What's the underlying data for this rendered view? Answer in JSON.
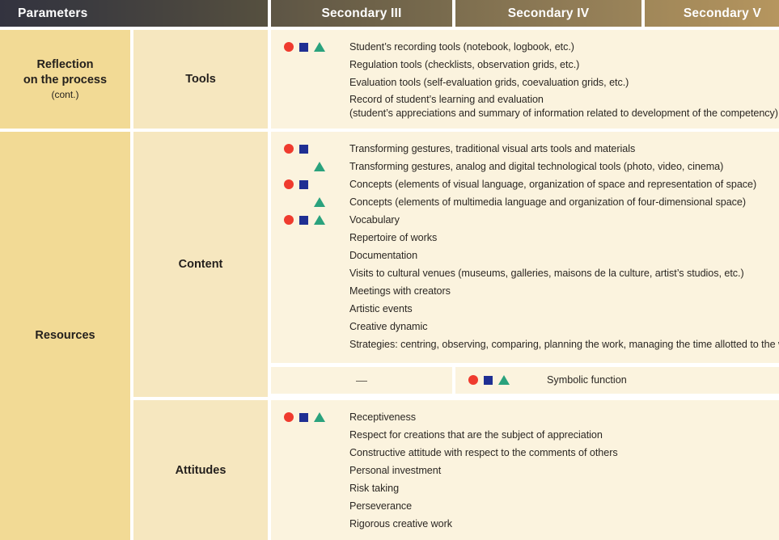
{
  "header": {
    "parameters_label": "Parameters",
    "columns": [
      {
        "label": "Secondary III"
      },
      {
        "label": "Secondary IV"
      },
      {
        "label": "Secondary V"
      }
    ]
  },
  "colors": {
    "circle": "#ef3b2e",
    "square": "#1f2f93",
    "triangle": "#2aa27d",
    "col1_bg": "#f2da95",
    "col2_bg": "#f6e7bf",
    "content_bg": "#fbf3de"
  },
  "parameters": {
    "reflection": {
      "title": "Reflection\non the process",
      "line1": "Reflection",
      "line2": "on the process",
      "note": "(cont.)"
    },
    "resources": {
      "label": "Resources"
    }
  },
  "sub_parameters": {
    "tools": "Tools",
    "content": "Content",
    "attitudes": "Attitudes"
  },
  "sections": {
    "tools": {
      "items": [
        {
          "marks": [
            "circle",
            "square",
            "triangle"
          ],
          "text": "Student’s recording tools (notebook, logbook, etc.)"
        },
        {
          "marks": [],
          "text": "Regulation tools (checklists, observation grids, etc.)"
        },
        {
          "marks": [],
          "text": "Evaluation tools (self-evaluation grids, coevaluation grids, etc.)"
        },
        {
          "marks": [],
          "text": "Record of student’s learning and evaluation",
          "text2": "(student’s appreciations and summary of information related to development of the competency)"
        }
      ]
    },
    "content": {
      "items": [
        {
          "marks": [
            "circle",
            "square"
          ],
          "text": "Transforming gestures, traditional visual arts tools and materials"
        },
        {
          "marks": [
            "triangle"
          ],
          "text": "Transforming gestures, analog and digital technological tools (photo, video, cinema)"
        },
        {
          "marks": [
            "circle",
            "square"
          ],
          "text": "Concepts (elements of visual language, organization of space and representation of space)"
        },
        {
          "marks": [
            "triangle"
          ],
          "text": "Concepts (elements of multimedia language and organization of four-dimensional space)"
        },
        {
          "marks": [
            "circle",
            "square",
            "triangle"
          ],
          "text": "Vocabulary"
        },
        {
          "marks": [],
          "text": "Repertoire of works"
        },
        {
          "marks": [],
          "text": "Documentation"
        },
        {
          "marks": [],
          "text": "Visits to cultural venues (museums, galleries, maisons de la culture, artist’s studios, etc.)"
        },
        {
          "marks": [],
          "text": "Meetings with creators"
        },
        {
          "marks": [],
          "text": "Artistic events"
        },
        {
          "marks": [],
          "text": "Creative dynamic"
        },
        {
          "marks": [],
          "text": "Strategies: centring, observing, comparing, planning the work, managing the time allotted to the work"
        }
      ]
    },
    "symbolic_row": {
      "dash": "—",
      "marks": [
        "circle",
        "square",
        "triangle"
      ],
      "text": "Symbolic function"
    },
    "attitudes": {
      "items": [
        {
          "marks": [
            "circle",
            "square",
            "triangle"
          ],
          "text": "Receptiveness"
        },
        {
          "marks": [],
          "text": "Respect for creations that are the subject of appreciation"
        },
        {
          "marks": [],
          "text": "Constructive attitude with respect to the comments of others"
        },
        {
          "marks": [],
          "text": "Personal investment"
        },
        {
          "marks": [],
          "text": "Risk taking"
        },
        {
          "marks": [],
          "text": "Perseverance"
        },
        {
          "marks": [],
          "text": "Rigorous creative work"
        }
      ]
    }
  }
}
